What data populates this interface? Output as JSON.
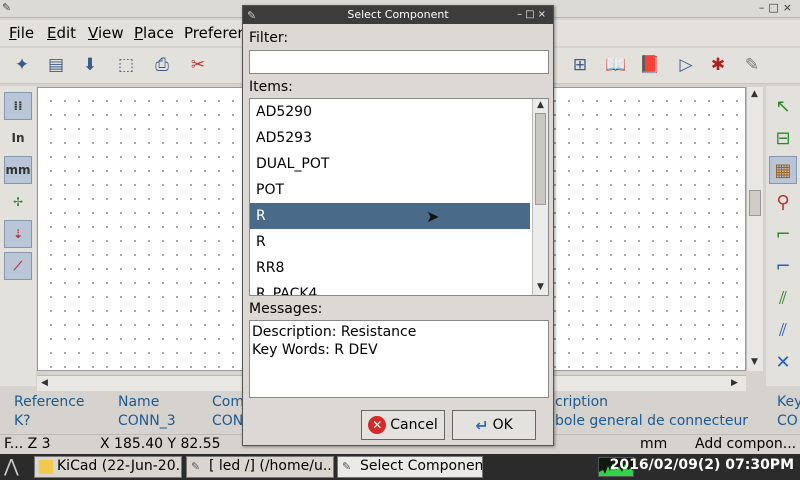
{
  "main_window": {
    "menu": [
      "File",
      "Edit",
      "View",
      "Place",
      "Preferen"
    ],
    "menu_underline": [
      "F",
      "E",
      "V",
      "P",
      "n"
    ],
    "msg_panel": {
      "reference_label": "Reference",
      "reference_value": "K?",
      "name_label": "Name",
      "name_value": "CONN_3",
      "comp_label": "Com",
      "comp_value": "CON",
      "desc_label": "cription",
      "desc_value": "bole general de connecteur",
      "key_label": "Key",
      "key_value": "CO"
    },
    "status": {
      "zoom": "F... Z 3",
      "coords": "X 185.40  Y 82.55",
      "units": "mm",
      "action": "Add compon..."
    }
  },
  "taskbar": {
    "tasks": [
      "KiCad (22-Jun-20...",
      "[ led /] (/home/u...",
      "Select Component"
    ],
    "clock": "2016/02/09(2) 07:30PM"
  },
  "dialog": {
    "title": "Select Component",
    "filter_label": "Filter:",
    "filter_value": "",
    "items_label": "Items:",
    "items": [
      "AD5290",
      "AD5293",
      "DUAL_POT",
      "POT",
      "R",
      "R",
      "RR8",
      "R_PACK4"
    ],
    "selected_index": 4,
    "messages_label": "Messages:",
    "message_lines": [
      "Description: Resistance",
      "Key Words: R DEV"
    ],
    "cancel_label": "Cancel",
    "ok_label": "OK"
  },
  "colors": {
    "selection": "#4a6a8a",
    "msg_panel_text": "#1c5a8f",
    "taskbar": "#2b2b2b"
  }
}
